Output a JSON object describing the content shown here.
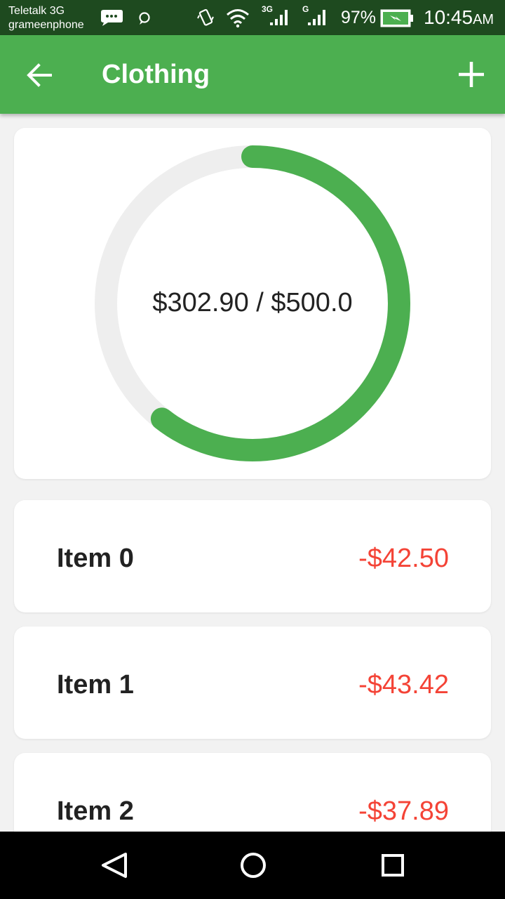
{
  "status_bar": {
    "carrier_1": "Teletalk 3G",
    "carrier_2": "grameenphone",
    "network_1_label": "3G",
    "network_2_label": "G",
    "battery": "97%",
    "time": "10:45",
    "time_suffix": "AM",
    "icons": [
      "message-icon",
      "chat-icon",
      "vibrate-icon",
      "wifi-icon",
      "signal-icon",
      "signal-icon",
      "battery-charging-icon"
    ]
  },
  "app_bar": {
    "title": "Clothing",
    "back_icon": "arrow-left-icon",
    "add_icon": "plus-icon",
    "color": "#4caf50"
  },
  "budget": {
    "spent": "$302.90",
    "separator": "/",
    "total": "$500.0",
    "progress": 0.6058,
    "progress_color": "#4caf50",
    "track_color": "#eeeeee"
  },
  "items": [
    {
      "name": "Item 0",
      "amount": "-$42.50"
    },
    {
      "name": "Item 1",
      "amount": "-$43.42"
    },
    {
      "name": "Item 2",
      "amount": "-$37.89"
    }
  ],
  "amount_color": "#f44336",
  "nav_bar": {
    "icons": [
      "back-triangle-icon",
      "home-circle-icon",
      "recents-square-icon"
    ]
  }
}
